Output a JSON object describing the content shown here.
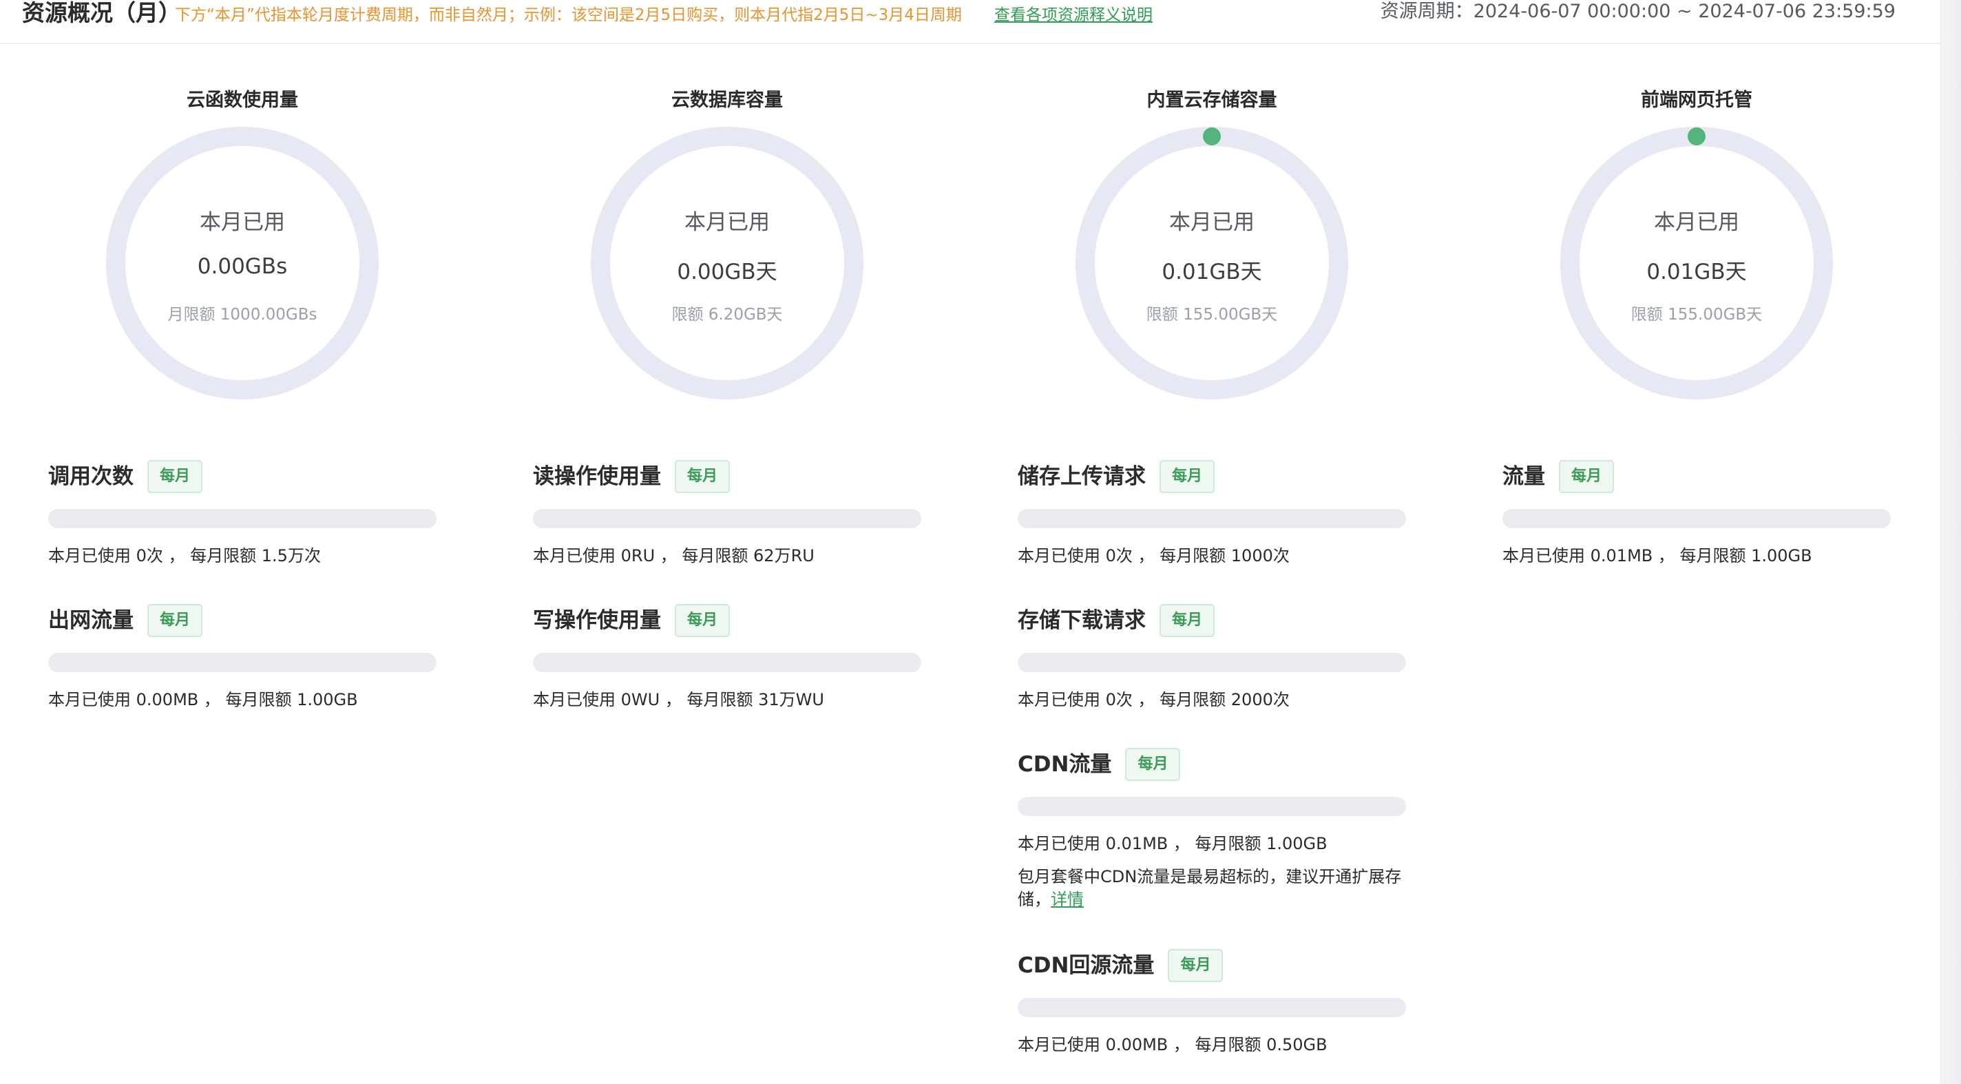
{
  "header": {
    "title": "资源概况（月）",
    "note": "下方“本月”代指本轮月度计费周期，而非自然月；示例：该空间是2月5日购买，则本月代指2月5日~3月4日周期",
    "link": "查看各项资源释义说明",
    "period": "资源周期：2024-06-07 00:00:00 ~ 2024-07-06 23:59:59"
  },
  "gauges": [
    {
      "title": "云函数使用量",
      "used_label": "本月已用",
      "value": "0.00GBs",
      "limit": "月限额 1000.00GBs",
      "used_fraction": 0,
      "dot_visible": false
    },
    {
      "title": "云数据库容量",
      "used_label": "本月已用",
      "value": "0.00GB天",
      "limit": "限额 6.20GB天",
      "used_fraction": 0,
      "dot_visible": false
    },
    {
      "title": "内置云存储容量",
      "used_label": "本月已用",
      "value": "0.01GB天",
      "limit": "限额 155.00GB天",
      "used_fraction": 0,
      "dot_visible": true
    },
    {
      "title": "前端网页托管",
      "used_label": "本月已用",
      "value": "0.01GB天",
      "limit": "限额 155.00GB天",
      "used_fraction": 0,
      "dot_visible": true
    }
  ],
  "metrics": {
    "col1": [
      {
        "name": "调用次数",
        "badge": "每月",
        "usage": "本月已使用 0次 ， 每月限额 1.5万次",
        "fill": 0
      },
      {
        "name": "出网流量",
        "badge": "每月",
        "usage": "本月已使用 0.00MB ， 每月限额 1.00GB",
        "fill": 0
      }
    ],
    "col2": [
      {
        "name": "读操作使用量",
        "badge": "每月",
        "usage": "本月已使用 0RU ， 每月限额 62万RU",
        "fill": 0
      },
      {
        "name": "写操作使用量",
        "badge": "每月",
        "usage": "本月已使用 0WU ， 每月限额 31万WU",
        "fill": 0
      }
    ],
    "col3": [
      {
        "name": "储存上传请求",
        "badge": "每月",
        "usage": "本月已使用 0次 ， 每月限额 1000次",
        "fill": 0
      },
      {
        "name": "存储下载请求",
        "badge": "每月",
        "usage": "本月已使用 0次 ， 每月限额 2000次",
        "fill": 0
      },
      {
        "name": "CDN流量",
        "badge": "每月",
        "usage": "本月已使用 0.01MB ， 每月限额 1.00GB",
        "fill": 0,
        "tip": "包月套餐中CDN流量是最易超标的，建议开通扩展存储，",
        "tip_link": "详情"
      },
      {
        "name": "CDN回源流量",
        "badge": "每月",
        "usage": "本月已使用 0.00MB ， 每月限额 0.50GB",
        "fill": 0
      }
    ],
    "col4": [
      {
        "name": "流量",
        "badge": "每月",
        "usage": "本月已使用 0.01MB ， 每月限额 1.00GB",
        "fill": 0
      }
    ]
  },
  "colors": {
    "ring_track": "#e6e9f3",
    "accent_green": "#52b57a",
    "note_orange": "#e8932c",
    "link_green": "#2f9c54"
  }
}
